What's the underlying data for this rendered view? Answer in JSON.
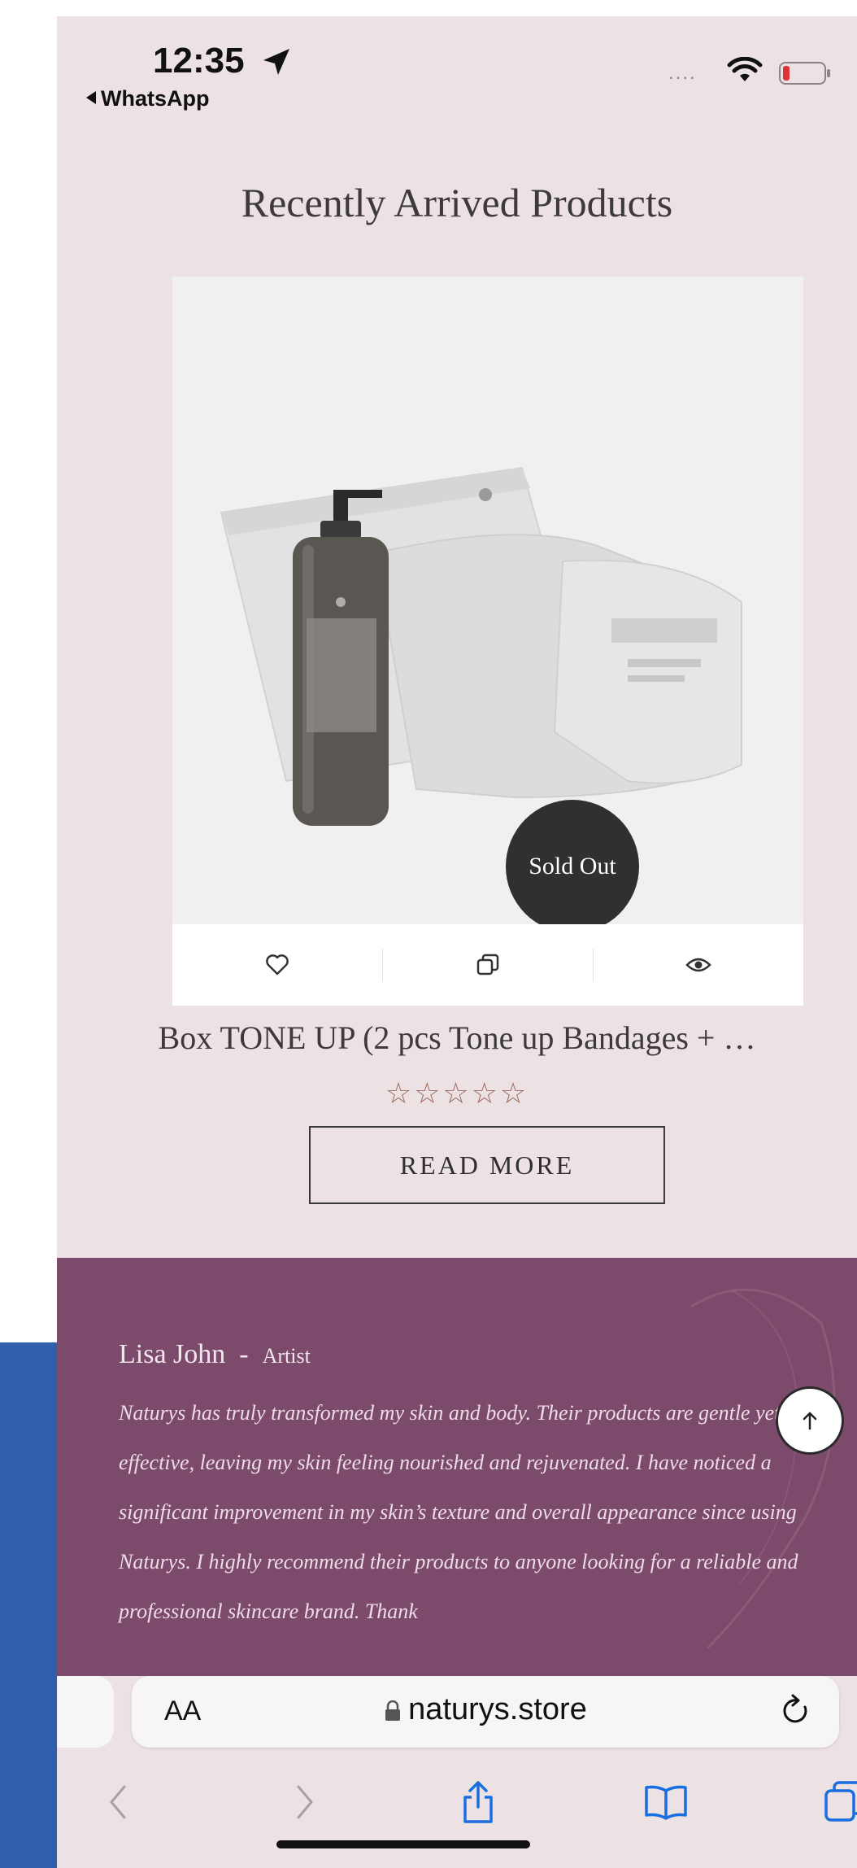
{
  "status_bar": {
    "time": "12:35",
    "back_label": "WhatsApp",
    "signal_dots": "....",
    "location-icon": "location-arrow-icon",
    "wifi-icon": "wifi-icon",
    "battery-icon": "battery-icon"
  },
  "section": {
    "title": "Recently Arrived Products"
  },
  "product": {
    "badge": "Sold Out",
    "title": "Box TONE UP (2 pcs Tone up Bandages + …",
    "rating_stars": "☆☆☆☆☆",
    "rating": 0,
    "read_more_label": "READ MORE",
    "actions": [
      "heart-icon",
      "compare-icon",
      "eye-icon"
    ]
  },
  "testimonial": {
    "name": "Lisa John",
    "separator": "-",
    "role": "Artist",
    "quote": "Naturys has truly transformed my skin and body. Their products are gentle yet effective, leaving my skin feeling nourished and rejuvenated. I have noticed a significant improvement in my skin’s texture and overall appearance since using Naturys. I highly recommend their products to anyone looking for a reliable and professional skincare brand. Thank"
  },
  "safari": {
    "aa_label": "AA",
    "url": "naturys.store"
  },
  "colors": {
    "page_bg": "#ece1e3",
    "testimonial_bg": "#7c4a6a",
    "badge_bg": "#303030",
    "star_color": "#9a6e5e",
    "link_blue": "#1a6fe0",
    "side_panel_blue": "#2f5fad"
  }
}
